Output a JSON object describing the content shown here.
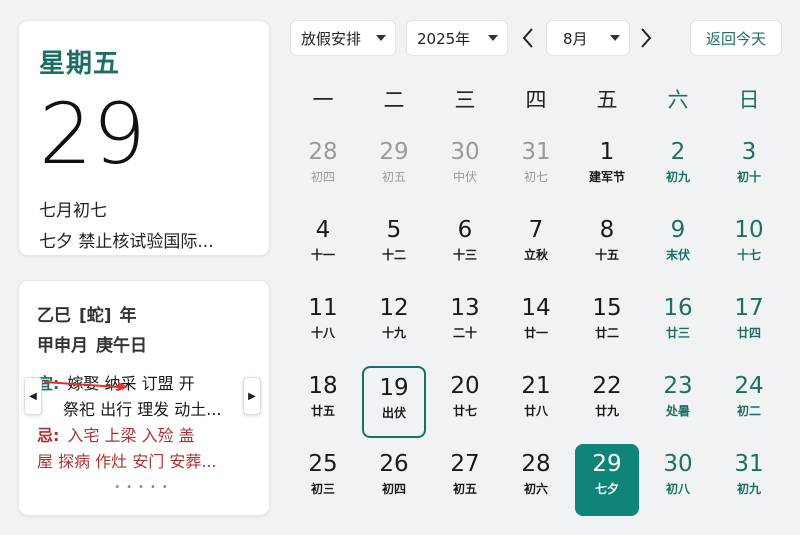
{
  "day_card": {
    "weekday": "星期五",
    "day": "29",
    "lunar": "七月初七",
    "festival": "七夕 禁止核试验国际..."
  },
  "almanac": {
    "year": [
      "乙巳",
      "[蛇]",
      "年"
    ],
    "month_day": [
      "甲申月",
      "庚午日"
    ],
    "yi_label": "宜:",
    "yi_line1": "嫁娶 纳采 订盟 开",
    "yi_line2": "祭祀 出行 理发 动土...",
    "ji_label": "忌:",
    "ji_line1": "入宅 上梁 入殓 盖",
    "ji_line2": "屋 探病 作灶 安门 安葬...",
    "dots": "•••••"
  },
  "toolbar": {
    "holiday": "放假安排",
    "year": "2025年",
    "month": "8月",
    "today": "返回今天"
  },
  "weekdays": [
    "一",
    "二",
    "三",
    "四",
    "五",
    "六",
    "日"
  ],
  "weeks": [
    [
      {
        "n": "28",
        "s": "初四",
        "other": true
      },
      {
        "n": "29",
        "s": "初五",
        "other": true
      },
      {
        "n": "30",
        "s": "中伏",
        "other": true
      },
      {
        "n": "31",
        "s": "初七",
        "other": true
      },
      {
        "n": "1",
        "s": "建军节"
      },
      {
        "n": "2",
        "s": "初九"
      },
      {
        "n": "3",
        "s": "初十"
      }
    ],
    [
      {
        "n": "4",
        "s": "十一"
      },
      {
        "n": "5",
        "s": "十二"
      },
      {
        "n": "6",
        "s": "十三"
      },
      {
        "n": "7",
        "s": "立秋"
      },
      {
        "n": "8",
        "s": "十五"
      },
      {
        "n": "9",
        "s": "末伏"
      },
      {
        "n": "10",
        "s": "十七"
      }
    ],
    [
      {
        "n": "11",
        "s": "十八"
      },
      {
        "n": "12",
        "s": "十九"
      },
      {
        "n": "13",
        "s": "二十"
      },
      {
        "n": "14",
        "s": "廿一"
      },
      {
        "n": "15",
        "s": "廿二"
      },
      {
        "n": "16",
        "s": "廿三"
      },
      {
        "n": "17",
        "s": "廿四"
      }
    ],
    [
      {
        "n": "18",
        "s": "廿五"
      },
      {
        "n": "19",
        "s": "出伏",
        "outlined": true
      },
      {
        "n": "20",
        "s": "廿七"
      },
      {
        "n": "21",
        "s": "廿八"
      },
      {
        "n": "22",
        "s": "廿九"
      },
      {
        "n": "23",
        "s": "处暑"
      },
      {
        "n": "24",
        "s": "初二"
      }
    ],
    [
      {
        "n": "25",
        "s": "初三"
      },
      {
        "n": "26",
        "s": "初四"
      },
      {
        "n": "27",
        "s": "初五"
      },
      {
        "n": "28",
        "s": "初六"
      },
      {
        "n": "29",
        "s": "七夕",
        "selected": true
      },
      {
        "n": "30",
        "s": "初八"
      },
      {
        "n": "31",
        "s": "初九"
      }
    ]
  ],
  "colors": {
    "accent": "#1d6f66",
    "selected_bg": "#0f857a",
    "ji_red": "#b03030",
    "muted": "#9a9a9a"
  }
}
